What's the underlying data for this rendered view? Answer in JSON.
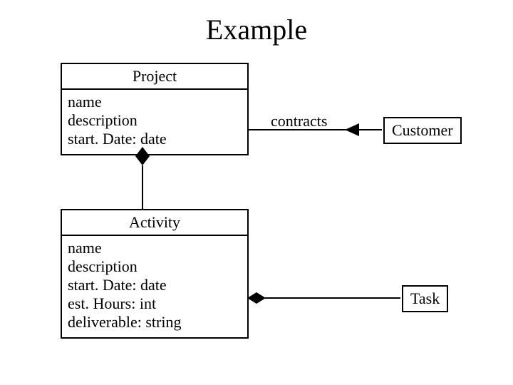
{
  "title": "Example",
  "classes": {
    "project": {
      "name": "Project",
      "attrs": [
        "name",
        "description",
        "start. Date: date"
      ]
    },
    "activity": {
      "name": "Activity",
      "attrs": [
        "name",
        "description",
        "start. Date: date",
        "est. Hours: int",
        "deliverable: string"
      ]
    },
    "customer": {
      "name": "Customer"
    },
    "task": {
      "name": "Task"
    }
  },
  "associations": {
    "contracts": "contracts"
  }
}
